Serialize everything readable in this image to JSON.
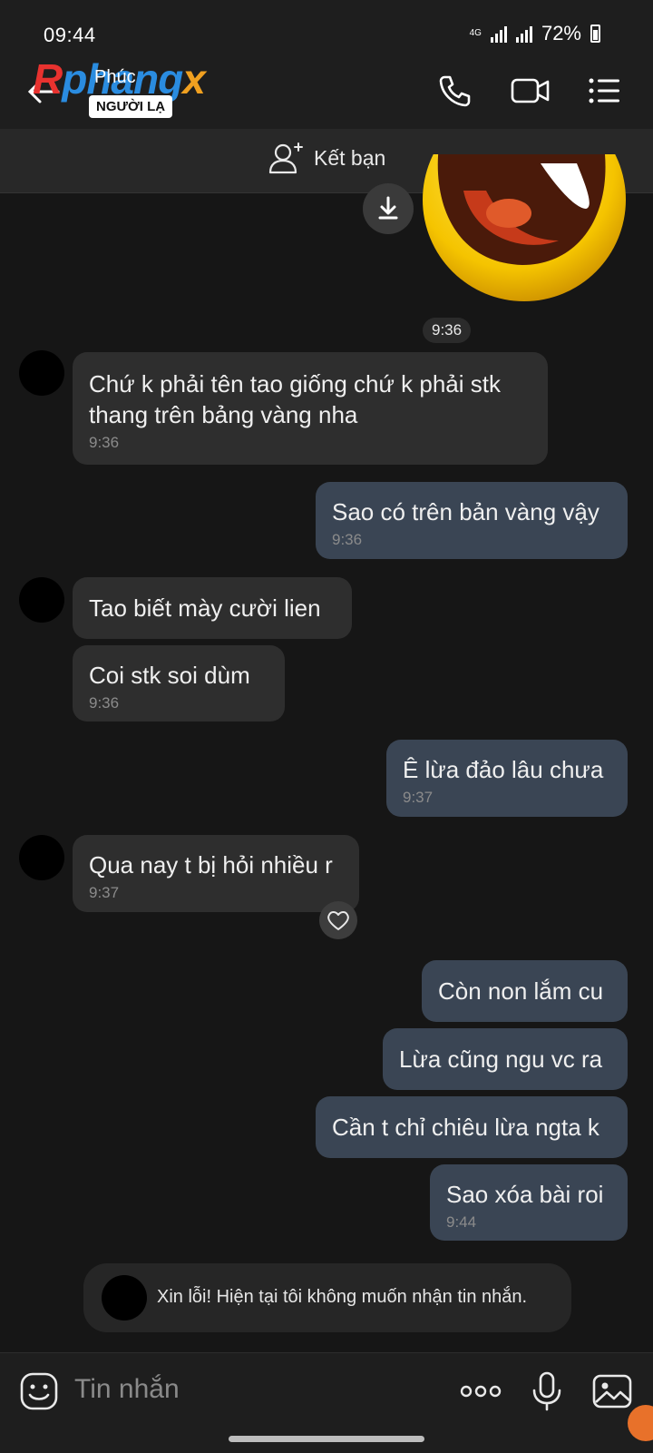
{
  "status": {
    "time": "09:44",
    "network": "4G",
    "battery": "72%"
  },
  "header": {
    "logo": {
      "part1": "R",
      "part2": "phang",
      "part3": "x"
    },
    "contact_name": "Phúc",
    "stranger_badge": "NGƯỜI LẠ"
  },
  "friend_bar": {
    "label": "Kết bạn"
  },
  "chat": {
    "sticker_time": "9:36",
    "messages": [
      {
        "dir": "in",
        "lines": [
          "Chứ k phải tên tao giống chứ k phải stk",
          "thang trên bảng vàng nha"
        ],
        "time": "9:36"
      },
      {
        "dir": "out",
        "lines": [
          "Sao có trên bản vàng vậy"
        ],
        "time": "9:36"
      },
      {
        "dir": "in",
        "lines": [
          "Tao biết mày cười lien"
        ],
        "time": ""
      },
      {
        "dir": "in",
        "lines": [
          "Coi stk soi dùm"
        ],
        "time": "9:36"
      },
      {
        "dir": "out",
        "lines": [
          "Ê lừa đảo lâu chưa"
        ],
        "time": "9:37"
      },
      {
        "dir": "in",
        "lines": [
          "Qua nay t bị hỏi nhiều r"
        ],
        "time": "9:37"
      },
      {
        "dir": "out",
        "lines": [
          "Còn non lắm cu"
        ],
        "time": ""
      },
      {
        "dir": "out",
        "lines": [
          "Lừa cũng ngu vc ra"
        ],
        "time": ""
      },
      {
        "dir": "out",
        "lines": [
          "Cần t chỉ chiêu lừa ngta k"
        ],
        "time": ""
      },
      {
        "dir": "out",
        "lines": [
          "Sao xóa bài roi"
        ],
        "time": "9:44"
      }
    ],
    "auto_reply": "Xin lỗi! Hiện tại tôi không muốn nhận tin nhắn."
  },
  "input": {
    "placeholder": "Tin nhắn"
  },
  "colors": {
    "background": "#161616",
    "incoming_bubble": "#2e2e2e",
    "outgoing_bubble": "#3a4554",
    "timestamp": "#8b8b8b"
  }
}
